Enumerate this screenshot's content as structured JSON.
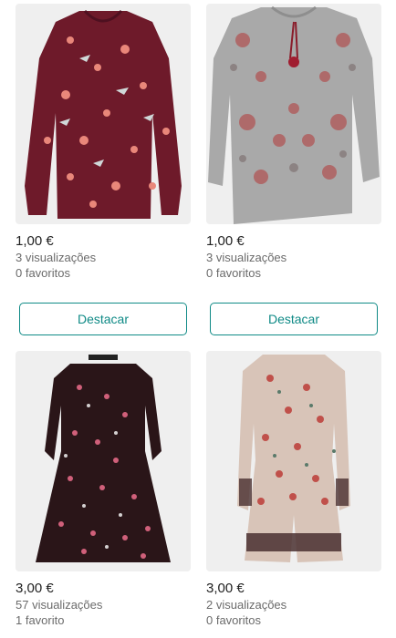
{
  "listings": [
    {
      "price": "1,00 €",
      "views": "3 visualizações",
      "favorites": "0 favoritos",
      "button": "Destacar",
      "photo_description": "burgundy floral blouse"
    },
    {
      "price": "1,00 €",
      "views": "3 visualizações",
      "favorites": "0 favoritos",
      "button": "Destacar",
      "photo_description": "grey embroidered sweatshirt"
    },
    {
      "price": "3,00 €",
      "views": "57 visualizações",
      "favorites": "1 favorito"
    },
    {
      "price": "3,00 €",
      "views": "2 visualizações",
      "favorites": "0 favoritos"
    }
  ],
  "colors": {
    "accent": "#0f8a86",
    "photo_bg": "#eeeeee"
  }
}
